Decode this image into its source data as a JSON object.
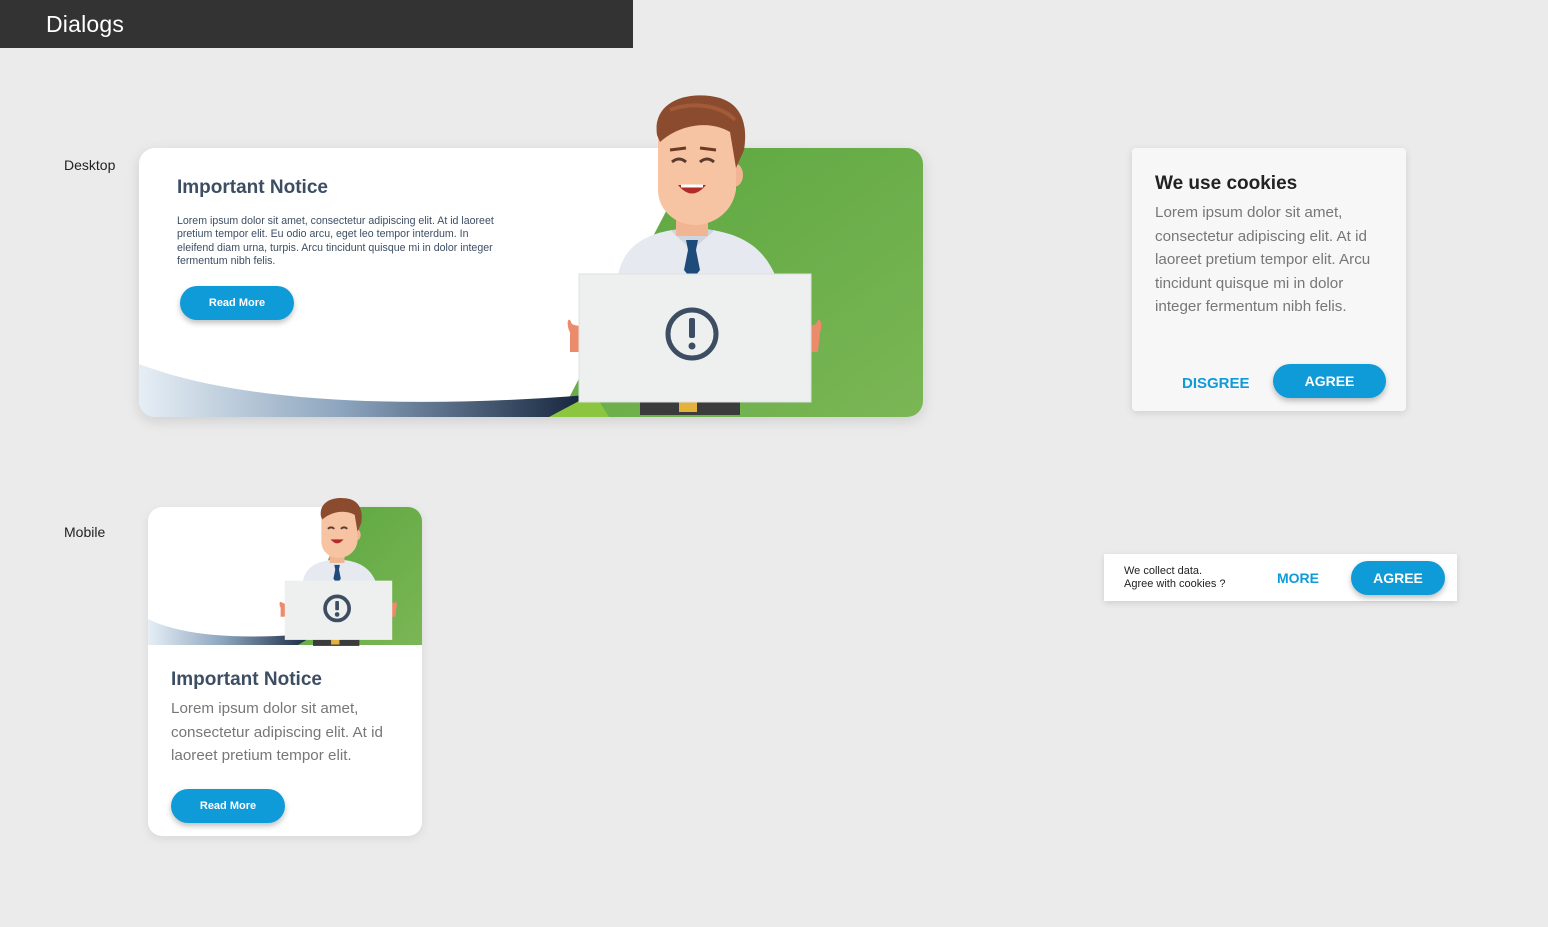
{
  "header": {
    "title": "Dialogs"
  },
  "labels": {
    "desktop": "Desktop",
    "mobile": "Mobile"
  },
  "colors": {
    "accent": "#0f9ad8",
    "green": "#6aae4a",
    "title_text": "#3d4e63",
    "header_bg": "#333333"
  },
  "desktop_notice": {
    "title": "Important Notice",
    "body": "Lorem ipsum dolor sit amet, consectetur adipiscing elit. At id laoreet pretium tempor elit. Eu odio arcu, eget leo tempor interdum. In eleifend diam urna, turpis. Arcu tincidunt quisque mi in dolor integer fermentum nibh felis.",
    "button": "Read More",
    "illustration_icon": "exclamation-circle-icon"
  },
  "cookie_dialog": {
    "title": "We use cookies",
    "body": "Lorem ipsum dolor sit amet, consectetur adipiscing elit. At id laoreet pretium tempor elit. Arcu tincidunt quisque mi in dolor integer fermentum nibh felis.",
    "disagree": "DISGREE",
    "agree": "AGREE"
  },
  "mobile_notice": {
    "title": "Important Notice",
    "body": "Lorem ipsum dolor sit amet, consectetur adipiscing elit. At id laoreet pretium tempor elit.",
    "button": "Read More"
  },
  "cookie_bar": {
    "line1": "We collect data.",
    "line2": "Agree with cookies ?",
    "more": "MORE",
    "agree": "AGREE"
  }
}
